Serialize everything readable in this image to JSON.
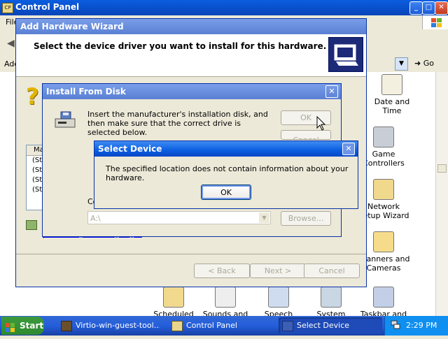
{
  "control_panel": {
    "title": "Control Panel",
    "menu_file": "File",
    "address_label": "Address",
    "go_label": "Go",
    "icons": [
      {
        "label": "Date and Time",
        "color": "#c4a048"
      },
      {
        "label": "Game Controllers",
        "color": "#7d8a99"
      },
      {
        "label": "Network Setup Wizard",
        "color": "#d6a93a"
      },
      {
        "label": "Scanners and Cameras",
        "color": "#e8c35a"
      }
    ],
    "bottom_icons": [
      {
        "label": "Scheduled",
        "color": "#d9b145"
      },
      {
        "label": "Sounds and",
        "color": "#d7d7d7"
      },
      {
        "label": "Speech",
        "color": "#7aa0d0"
      },
      {
        "label": "System",
        "color": "#6e8fb0"
      },
      {
        "label": "Taskbar and",
        "color": "#5b7bb3"
      }
    ]
  },
  "wizard": {
    "title": "Add Hardware Wizard",
    "header": "Select the device driver you want to install for this hardware.",
    "list_header": "Ma",
    "list_rows": [
      "(St",
      "(St",
      "(St",
      "(St"
    ],
    "copy_label": "Co",
    "link_fragment": "Tell me why driver signing is important",
    "back_label": "< Back",
    "next_label": "Next >",
    "cancel_label": "Cancel"
  },
  "install_from_disk": {
    "title": "Install From Disk",
    "message": "Insert the manufacturer's installation disk, and then make sure that the correct drive is selected below.",
    "ok_label": "OK",
    "cancel_label": "Cancel",
    "path_value": "A:\\",
    "browse_label": "Browse..."
  },
  "select_device": {
    "title": "Select Device",
    "message": "The specified location does not contain information about your hardware.",
    "ok_label": "OK"
  },
  "taskbar": {
    "start_label": "Start",
    "tasks": [
      {
        "label": "Virtio-win-guest-tool...",
        "active": false
      },
      {
        "label": "Control Panel",
        "active": false
      },
      {
        "label": "Select Device",
        "active": true
      }
    ],
    "clock": "2:29 PM"
  }
}
